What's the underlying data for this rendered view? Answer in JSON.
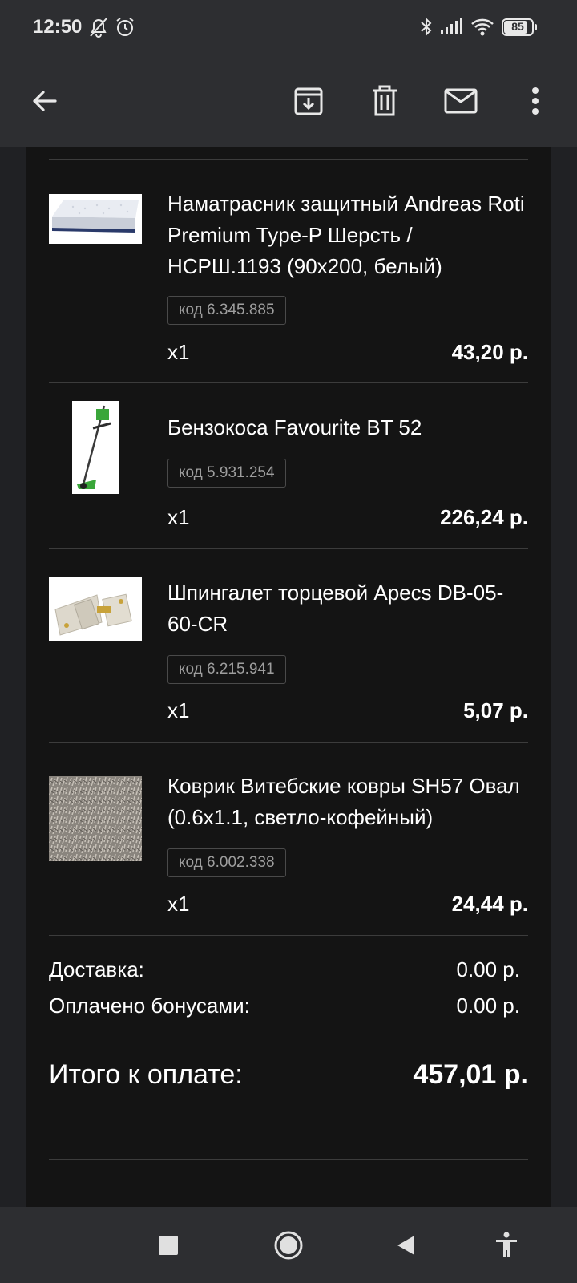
{
  "status_bar": {
    "time": "12:50",
    "battery_level": 85,
    "icons": [
      "bell-off-icon",
      "alarm-icon",
      "bluetooth-icon",
      "signal-icon",
      "wifi-icon",
      "battery-icon"
    ]
  },
  "toolbar": {
    "icons": [
      "back-arrow-icon",
      "archive-icon",
      "delete-icon",
      "mail-icon",
      "more-vert-icon"
    ]
  },
  "order": {
    "items": [
      {
        "name": "Наматрасник защитный Andreas Roti Premium Type-P Шерсть / НСРШ.1193 (90x200, белый)",
        "code": "код 6.345.885",
        "qty": "x1",
        "price": "43,20 р."
      },
      {
        "name": "Бензокоса Favourite BT 52",
        "code": "код 5.931.254",
        "qty": "x1",
        "price": "226,24 р."
      },
      {
        "name": "Шпингалет торцевой Apecs DB-05-60-CR",
        "code": "код 6.215.941",
        "qty": "x1",
        "price": "5,07 р."
      },
      {
        "name": "Коврик Витебские ковры SH57 Овал (0.6x1.1, светло-кофейный)",
        "code": "код 6.002.338",
        "qty": "x1",
        "price": "24,44 р."
      }
    ],
    "summary": {
      "delivery_label": "Доставка:",
      "delivery_value": "0.00 р.",
      "bonus_label": "Оплачено бонусами:",
      "bonus_value": "0.00 р.",
      "total_label": "Итого к оплате:",
      "total_value": "457,01 р."
    }
  },
  "nav_bar": {
    "icons": [
      "recents-square-icon",
      "home-circle-icon",
      "back-triangle-icon",
      "accessibility-icon"
    ]
  }
}
